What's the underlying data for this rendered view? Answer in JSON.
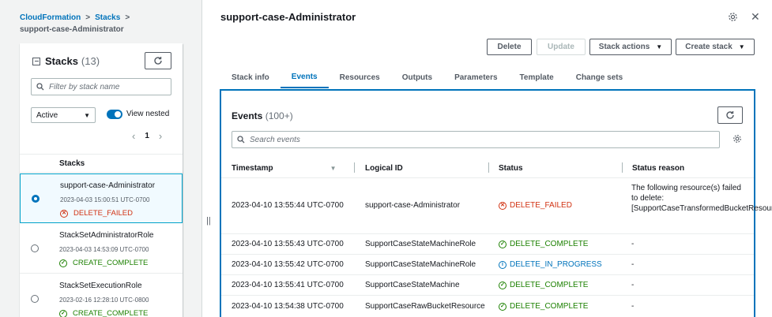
{
  "breadcrumb": {
    "items": [
      "CloudFormation",
      "Stacks"
    ],
    "current": "support-case-Administrator"
  },
  "stacks_panel": {
    "title": "Stacks",
    "count": "(13)",
    "search_placeholder": "Filter by stack name",
    "filter_value": "Active",
    "view_nested_label": "View nested",
    "page": "1",
    "column_header": "Stacks",
    "rows": [
      {
        "name": "support-case-Administrator",
        "date": "2023-04-03 15:00:51 UTC-0700",
        "status": "DELETE_FAILED",
        "status_kind": "failed",
        "selected": true
      },
      {
        "name": "StackSetAdministratorRole",
        "date": "2023-04-03 14:53:09 UTC-0700",
        "status": "CREATE_COMPLETE",
        "status_kind": "complete",
        "selected": false
      },
      {
        "name": "StackSetExecutionRole",
        "date": "2023-02-16 12:28:10 UTC-0800",
        "status": "CREATE_COMPLETE",
        "status_kind": "complete",
        "selected": false
      }
    ]
  },
  "detail": {
    "title": "support-case-Administrator",
    "buttons": {
      "delete": "Delete",
      "update": "Update",
      "stack_actions": "Stack actions",
      "create_stack": "Create stack"
    },
    "tabs": [
      "Stack info",
      "Events",
      "Resources",
      "Outputs",
      "Parameters",
      "Template",
      "Change sets"
    ],
    "active_tab": "Events"
  },
  "events": {
    "title": "Events",
    "count": "(100+)",
    "search_placeholder": "Search events",
    "columns": [
      "Timestamp",
      "Logical ID",
      "Status",
      "Status reason"
    ],
    "rows": [
      {
        "timestamp": "2023-04-10 13:55:44 UTC-0700",
        "logical_id": "support-case-Administrator",
        "status": "DELETE_FAILED",
        "status_kind": "failed",
        "reason": "The following resource(s) failed to delete: [SupportCaseTransformedBucketResource]."
      },
      {
        "timestamp": "2023-04-10 13:55:43 UTC-0700",
        "logical_id": "SupportCaseStateMachineRole",
        "status": "DELETE_COMPLETE",
        "status_kind": "complete",
        "reason": "-"
      },
      {
        "timestamp": "2023-04-10 13:55:42 UTC-0700",
        "logical_id": "SupportCaseStateMachineRole",
        "status": "DELETE_IN_PROGRESS",
        "status_kind": "progress",
        "reason": "-"
      },
      {
        "timestamp": "2023-04-10 13:55:41 UTC-0700",
        "logical_id": "SupportCaseStateMachine",
        "status": "DELETE_COMPLETE",
        "status_kind": "complete",
        "reason": "-"
      },
      {
        "timestamp": "2023-04-10 13:54:38 UTC-0700",
        "logical_id": "SupportCaseRawBucketResource",
        "status": "DELETE_COMPLETE",
        "status_kind": "complete",
        "reason": "-"
      }
    ]
  },
  "colors": {
    "accent": "#0073bb",
    "failed": "#d13212",
    "complete": "#1d8102",
    "progress": "#0073bb"
  }
}
